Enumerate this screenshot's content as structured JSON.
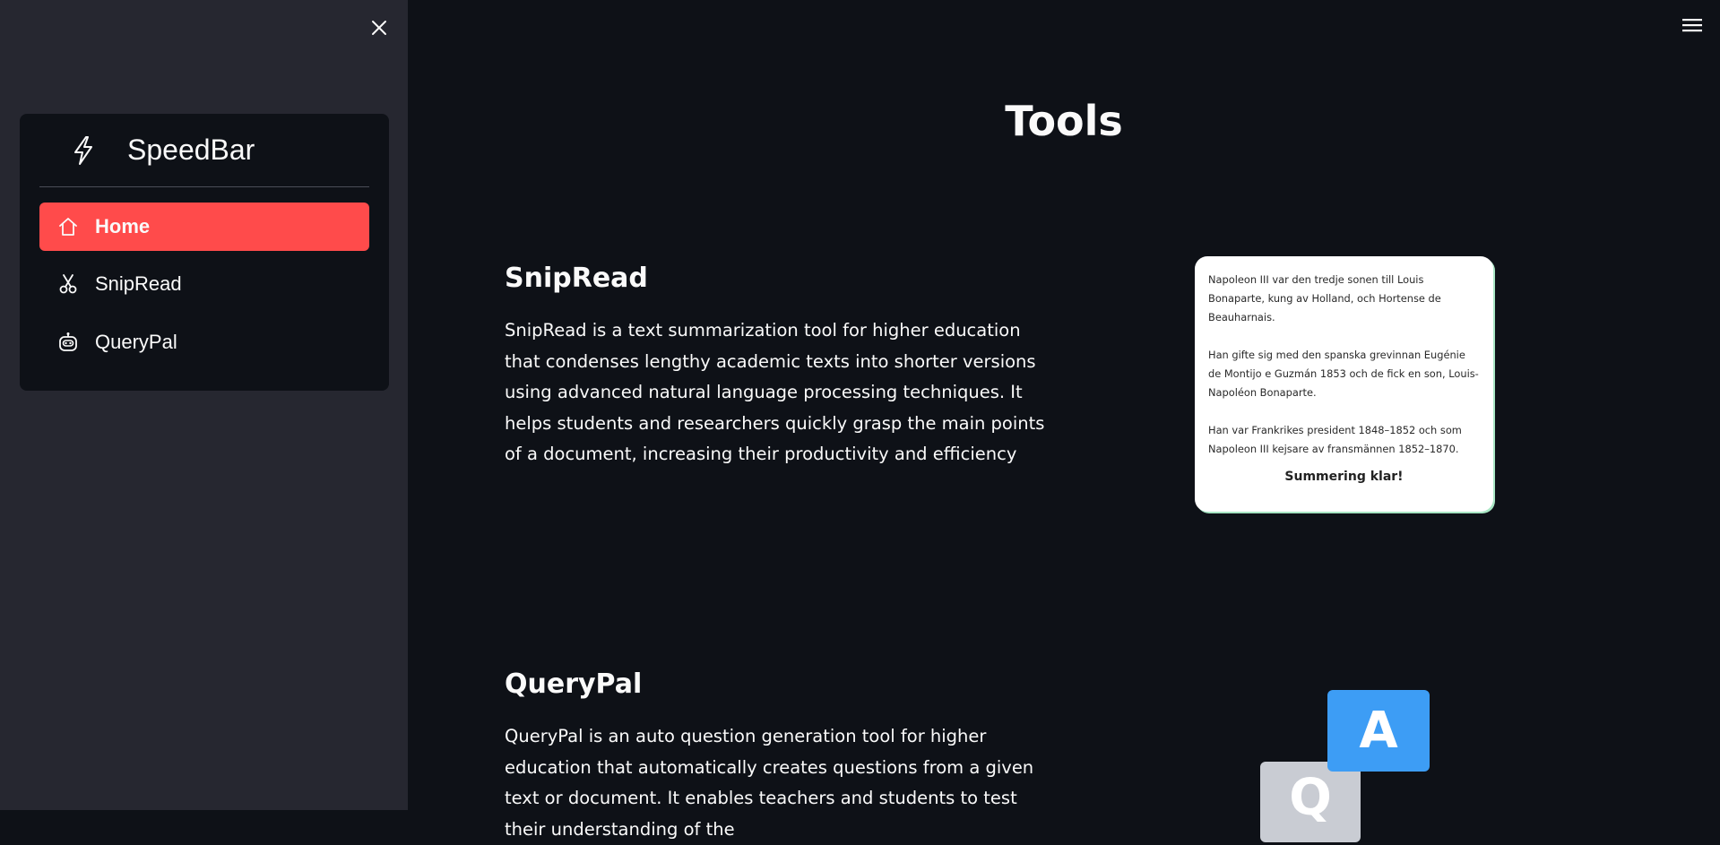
{
  "sidebar": {
    "close_icon": "close-icon",
    "brand": {
      "title": "SpeedBar",
      "icon": "lightning-bolt-icon"
    },
    "items": [
      {
        "label": "Home",
        "icon": "home-icon",
        "active": true
      },
      {
        "label": "SnipRead",
        "icon": "scissors-icon",
        "active": false
      },
      {
        "label": "QueryPal",
        "icon": "robot-icon",
        "active": false
      }
    ],
    "active_color": "#ff4b4b",
    "background": "#262730"
  },
  "header": {
    "menu_icon": "hamburger-menu-icon"
  },
  "main": {
    "title": "Tools",
    "sections": [
      {
        "title": "SnipRead",
        "description": "SnipRead is a text summarization tool for higher education that condenses lengthy academic texts into shorter versions using advanced natural language processing techniques. It helps students and researchers quickly grasp the main points of a document, increasing their productivity and efficiency",
        "preview": {
          "paragraphs": [
            "Napoleon III var den tredje sonen till Louis Bonaparte, kung av Holland, och Hortense de Beauharnais.",
            "Han gifte sig med den spanska grevinnan Eugénie de Montijo e Guzmán 1853 och de fick en son, Louis-Napoléon Bonaparte.",
            "Han var Frankrikes president 1848–1852 och som Napoleon III kejsare av fransmännen 1852–1870."
          ],
          "status": "Summering klar!"
        }
      },
      {
        "title": "QueryPal",
        "description": "QueryPal is an auto question generation tool for higher education that automatically creates questions from a given text or document. It enables teachers and students to test their understanding of the",
        "illustration": {
          "answer_letter": "A",
          "question_letter": "Q",
          "answer_color": "#3d9df5",
          "question_color": "#c9ccd3"
        }
      }
    ]
  }
}
